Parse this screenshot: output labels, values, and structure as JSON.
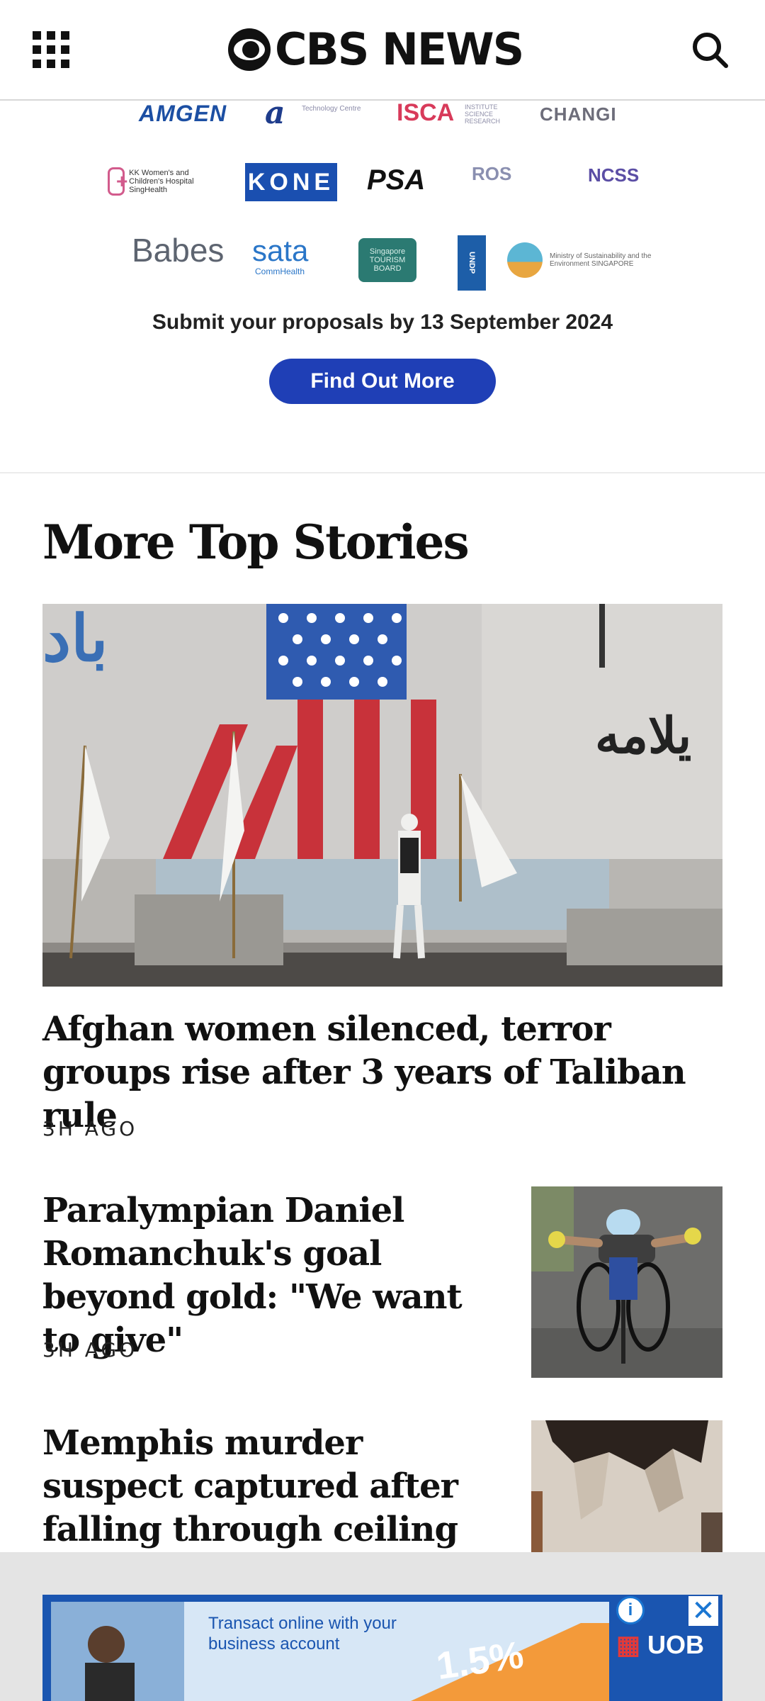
{
  "header": {
    "logo_text": "CBS NEWS",
    "menu_icon": "grid-menu-icon",
    "search_icon": "search-icon"
  },
  "ad_top": {
    "sponsors": {
      "amgen": "AMGEN",
      "a_small": "Technology Centre",
      "isca": "ISCA",
      "isca_small": "INSTITUTE SCIENCE RESEARCH",
      "changi": "CHANGI",
      "kk": "KK Women's and Children's Hospital SingHealth",
      "kone": "KONE",
      "psa": "PSA",
      "ros": "ROS",
      "ncss": "NCSS",
      "babes": "Babes",
      "sata": "sata",
      "sata_small": "CommHealth",
      "stb": "Singapore TOURISM BOARD",
      "undp": "UNDP",
      "mse": "Ministry of Sustainability and the Environment SINGAPORE"
    },
    "submit_text": "Submit your proposals by 13 September 2024",
    "cta_label": "Find Out More"
  },
  "section": {
    "title": "More Top Stories"
  },
  "stories": [
    {
      "headline": "Afghan women silenced, terror groups rise after 3 years of Taliban rule",
      "time": "3H AGO"
    },
    {
      "headline": "Paralympian Daniel Romanchuk's goal beyond gold: \"We want to give\"",
      "time": "3H AGO"
    },
    {
      "headline": "Memphis murder suspect captured after falling through ceiling",
      "time": ""
    }
  ],
  "ad_bottom": {
    "text_line1": "Transact online with your",
    "text_line2": "business account",
    "rate": "1.5%",
    "brand": "UOB",
    "info_icon": "info-icon",
    "close_icon": "close-icon"
  },
  "colors": {
    "cta_blue": "#1f3fb6",
    "banner_blue": "#1a55b0",
    "flag_red": "#c8323a",
    "flag_blue": "#2f5bb0"
  }
}
